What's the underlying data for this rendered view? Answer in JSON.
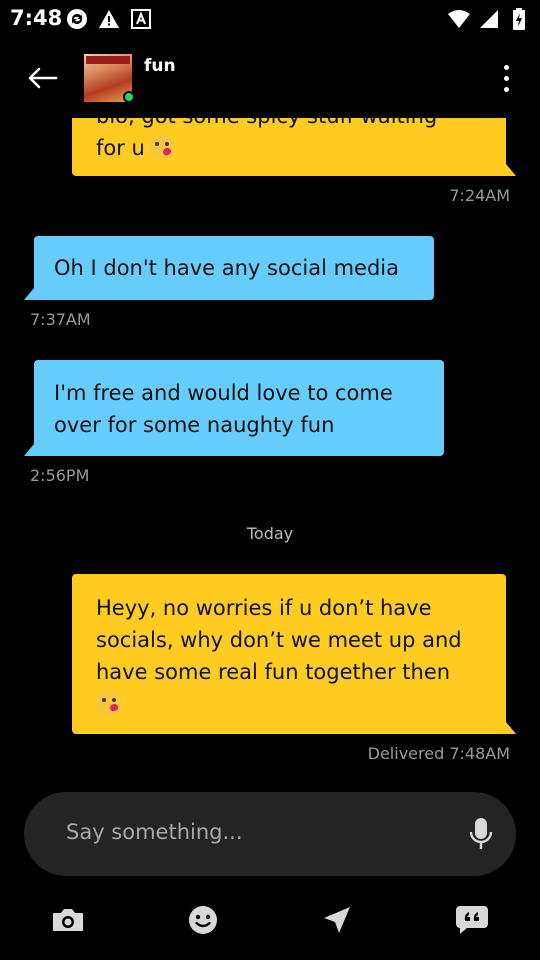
{
  "status_bar": {
    "time": "7:48",
    "icons_left": [
      "sync-icon",
      "warning-icon",
      "a-box-icon"
    ],
    "icons_right": [
      "wifi-icon",
      "signal-icon",
      "battery-icon"
    ]
  },
  "header": {
    "contact_name": "fun",
    "online": true,
    "icons": [
      "back-arrow-icon",
      "more-vertical-icon"
    ]
  },
  "messages": [
    {
      "direction": "outgoing",
      "text_lines": [
        "bio, got some spicy stuff waiting",
        "for u"
      ],
      "emoji": "kissing-face-heart",
      "time": "7:24AM"
    },
    {
      "direction": "incoming",
      "text": "Oh I don't have any social media",
      "time": "7:37AM"
    },
    {
      "direction": "incoming",
      "text_lines": [
        "I'm free and would love to come",
        "over for some naughty fun"
      ],
      "time": "2:56PM"
    },
    {
      "divider": "Today"
    },
    {
      "direction": "outgoing",
      "text_lines": [
        "Heyy, no worries if u don’t have",
        "socials, why don’t we meet up and",
        "have some real fun together then"
      ],
      "emoji": "kissing-face-heart",
      "time": "Delivered 7:48AM"
    }
  ],
  "input": {
    "placeholder": "Say something..."
  },
  "toolbar": {
    "icons": [
      "camera-icon",
      "emoji-icon",
      "location-send-icon",
      "quote-icon"
    ]
  },
  "colors": {
    "outgoing_bubble": "#ffcc1f",
    "incoming_bubble": "#66ccfc",
    "background": "#000000",
    "input_bg": "#242424"
  }
}
